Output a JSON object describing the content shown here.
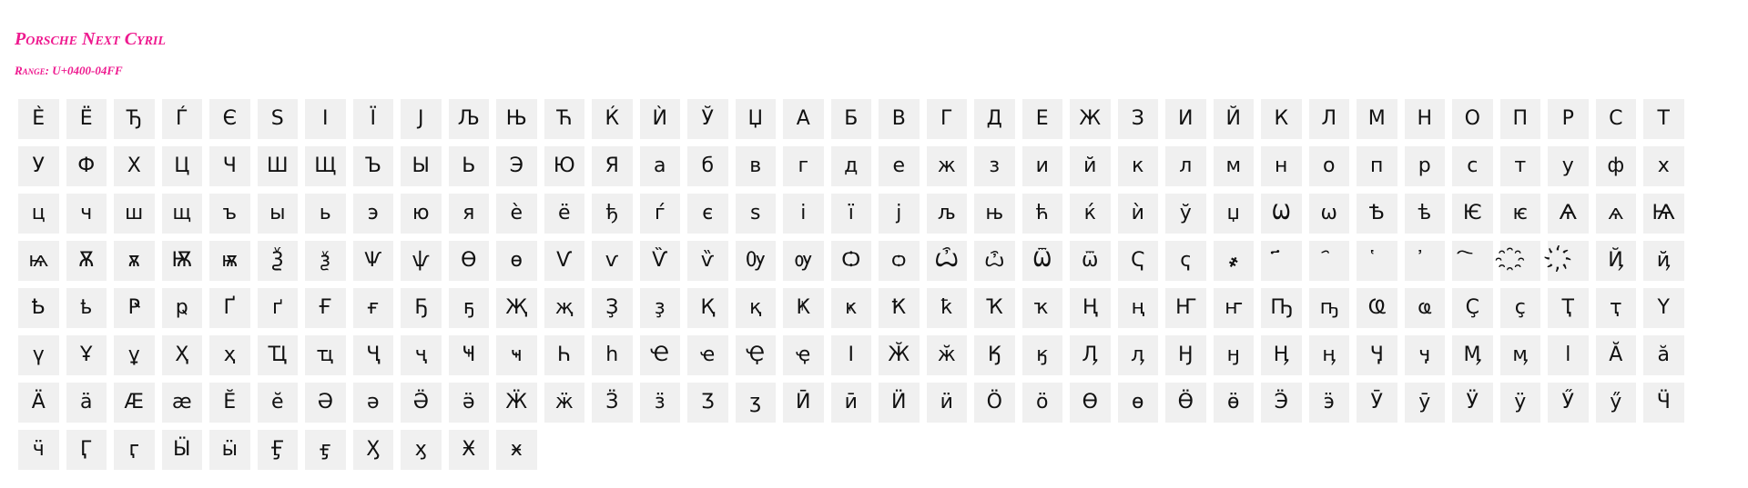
{
  "header": {
    "title": "Porsche Next Cyril",
    "range": "Range: U+0400-04FF",
    "accent_color": "#ee1a8f"
  },
  "glyphs": [
    "Ѐ",
    "Ё",
    "Ђ",
    "Ѓ",
    "Є",
    "Ѕ",
    "І",
    "Ї",
    "Ј",
    "Љ",
    "Њ",
    "Ћ",
    "Ќ",
    "Ѝ",
    "Ў",
    "Џ",
    "А",
    "Б",
    "В",
    "Г",
    "Д",
    "Е",
    "Ж",
    "З",
    "И",
    "Й",
    "К",
    "Л",
    "М",
    "Н",
    "О",
    "П",
    "Р",
    "С",
    "Т",
    "У",
    "Ф",
    "Х",
    "Ц",
    "Ч",
    "Ш",
    "Щ",
    "Ъ",
    "Ы",
    "Ь",
    "Э",
    "Ю",
    "Я",
    "а",
    "б",
    "в",
    "г",
    "д",
    "е",
    "ж",
    "з",
    "и",
    "й",
    "к",
    "л",
    "м",
    "н",
    "о",
    "п",
    "р",
    "с",
    "т",
    "у",
    "ф",
    "х",
    "ц",
    "ч",
    "ш",
    "щ",
    "ъ",
    "ы",
    "ь",
    "э",
    "ю",
    "я",
    "ѐ",
    "ё",
    "ђ",
    "ѓ",
    "є",
    "ѕ",
    "і",
    "ї",
    "ј",
    "љ",
    "њ",
    "ћ",
    "ќ",
    "ѝ",
    "ў",
    "џ",
    "Ѡ",
    "ѡ",
    "Ѣ",
    "ѣ",
    "Ѥ",
    "ѥ",
    "Ѧ",
    "ѧ",
    "Ѩ",
    "ѩ",
    "Ѫ",
    "ѫ",
    "Ѭ",
    "ѭ",
    "Ѯ",
    "ѯ",
    "Ѱ",
    "ѱ",
    "Ѳ",
    "ѳ",
    "Ѵ",
    "ѵ",
    "Ѷ",
    "ѷ",
    "Ѹ",
    "ѹ",
    "Ѻ",
    "ѻ",
    "Ѽ",
    "ѽ",
    "Ѿ",
    "ѿ",
    "Ҁ",
    "ҁ",
    "҂",
    "҃",
    "҄",
    "҅",
    "҆",
    "҇",
    "҈",
    "҉",
    "Ҋ",
    "ҋ",
    "Ҍ",
    "ҍ",
    "Ҏ",
    "ҏ",
    "Ґ",
    "ґ",
    "Ғ",
    "ғ",
    "Ҕ",
    "ҕ",
    "Җ",
    "җ",
    "Ҙ",
    "ҙ",
    "Қ",
    "қ",
    "Ҝ",
    "ҝ",
    "Ҟ",
    "ҟ",
    "Ҡ",
    "ҡ",
    "Ң",
    "ң",
    "Ҥ",
    "ҥ",
    "Ҧ",
    "ҧ",
    "Ҩ",
    "ҩ",
    "Ҫ",
    "ҫ",
    "Ҭ",
    "ҭ",
    "Ү",
    "ү",
    "Ұ",
    "ұ",
    "Ҳ",
    "ҳ",
    "Ҵ",
    "ҵ",
    "Ҷ",
    "ҷ",
    "Ҹ",
    "ҹ",
    "Һ",
    "һ",
    "Ҽ",
    "ҽ",
    "Ҿ",
    "ҿ",
    "Ӏ",
    "Ӂ",
    "ӂ",
    "Ӄ",
    "ӄ",
    "Ӆ",
    "ӆ",
    "Ӈ",
    "ӈ",
    "Ӊ",
    "ӊ",
    "Ӌ",
    "ӌ",
    "Ӎ",
    "ӎ",
    "ӏ",
    "Ӑ",
    "ӑ",
    "Ӓ",
    "ӓ",
    "Ӕ",
    "ӕ",
    "Ӗ",
    "ӗ",
    "Ә",
    "ә",
    "Ӛ",
    "ӛ",
    "Ӝ",
    "ӝ",
    "Ӟ",
    "ӟ",
    "Ӡ",
    "ӡ",
    "Ӣ",
    "ӣ",
    "Ӥ",
    "ӥ",
    "Ӧ",
    "ӧ",
    "Ө",
    "ө",
    "Ӫ",
    "ӫ",
    "Ӭ",
    "ӭ",
    "Ӯ",
    "ӯ",
    "Ӱ",
    "ӱ",
    "Ӳ",
    "ӳ",
    "Ӵ",
    "ӵ",
    "Ӷ",
    "ӷ",
    "Ӹ",
    "ӹ",
    "Ӻ",
    "ӻ",
    "Ӽ",
    "ӽ",
    "Ӿ",
    "ӿ"
  ]
}
